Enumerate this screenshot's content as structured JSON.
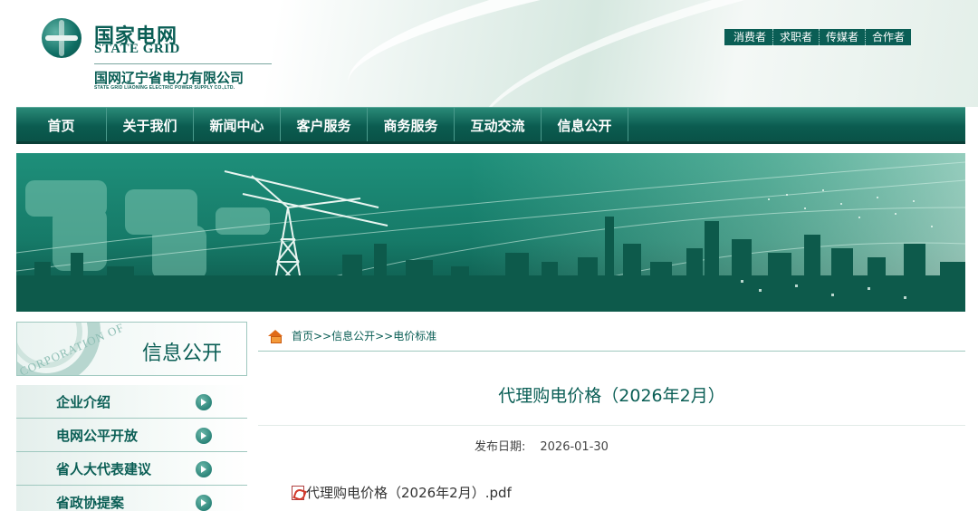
{
  "header": {
    "brand_cn": "国家电网",
    "brand_en": "STATE GRID",
    "company_cn": "国网辽宁省电力有限公司",
    "company_en": "STATE GRID LIAONING ELECTRIC POWER SUPPLY CO.,LTD.",
    "links": [
      "消费者",
      "求职者",
      "传媒者",
      "合作者"
    ]
  },
  "nav": {
    "items": [
      "首页",
      "关于我们",
      "新闻中心",
      "客户服务",
      "商务服务",
      "互动交流",
      "信息公开"
    ]
  },
  "sidebar": {
    "title": "信息公开",
    "emblem_text": "CORPORATION OF",
    "items": [
      "企业介绍",
      "电网公平开放",
      "省人大代表建议",
      "省政协提案"
    ]
  },
  "breadcrumb": "首页>>信息公开>>电价标准",
  "article": {
    "title": "代理购电价格（2026年2月）",
    "date_label": "发布日期:",
    "date_value": "2026-01-30",
    "attachment": "代理购电价格（2026年2月）.pdf"
  },
  "colors": {
    "brand": "#0a5e55",
    "nav_top": "#2a8a78",
    "accent_home": "#e06a18"
  }
}
